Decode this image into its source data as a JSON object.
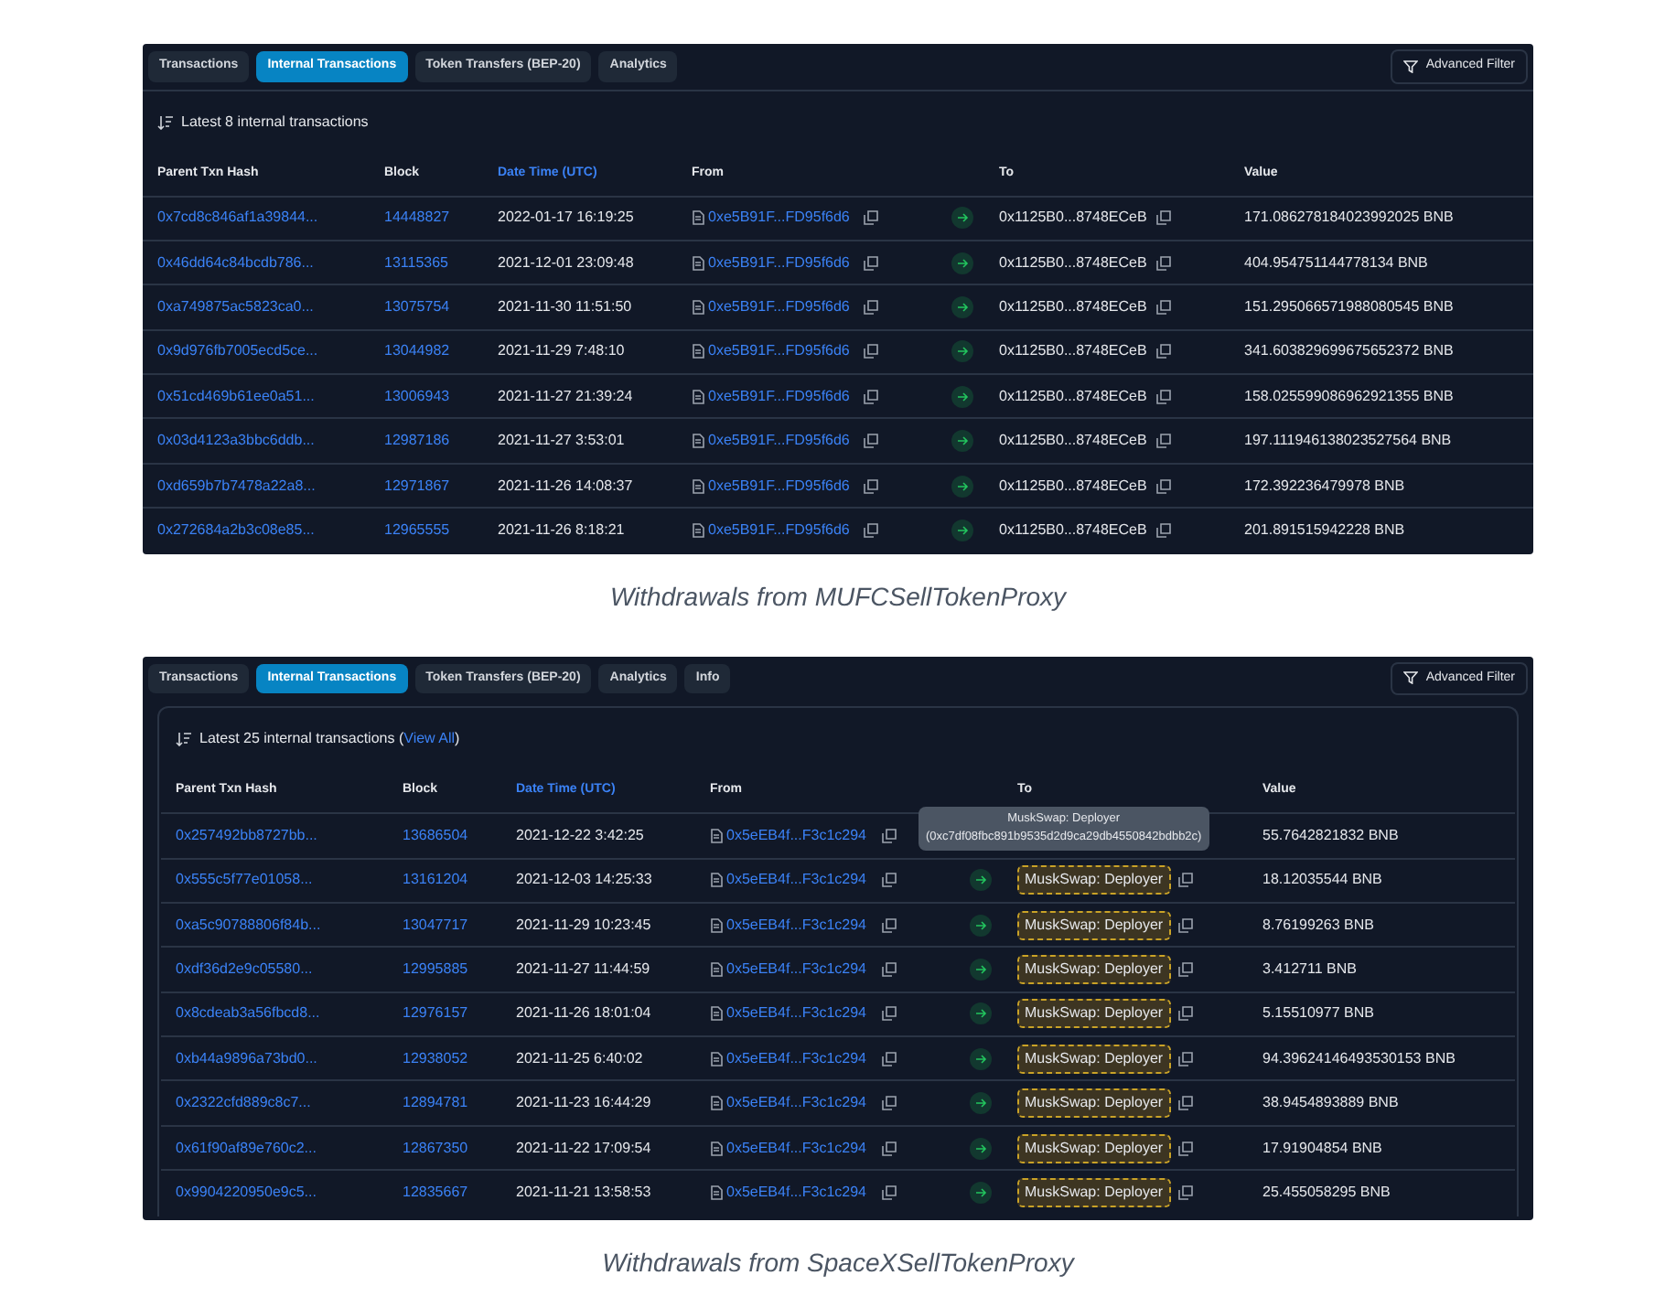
{
  "figures": [
    {
      "tabs": [
        {
          "label": "Transactions",
          "selected": false
        },
        {
          "label": "Internal Transactions",
          "selected": true
        },
        {
          "label": "Token Transfers (BEP-20)",
          "selected": false
        },
        {
          "label": "Analytics",
          "selected": false
        }
      ],
      "filter_button": "Advanced Filter",
      "inner_card": false,
      "summary": "Latest 8 internal transactions",
      "columns": [
        {
          "label": "Parent Txn Hash",
          "sortable": false
        },
        {
          "label": "Block",
          "sortable": false
        },
        {
          "label": "Date Time (UTC)",
          "sortable": true
        },
        {
          "label": "From",
          "sortable": false
        },
        {
          "label": "To",
          "sortable": false
        },
        {
          "label": "Value",
          "sortable": false
        }
      ],
      "rows": [
        {
          "hash": "0x7cd8c846af1a39844...",
          "block": "14448827",
          "time": "2022-01-17 16:19:25",
          "from": "0xe5B91F...FD95f6d6",
          "to": {
            "kind": "address",
            "text": "0x1125B0...8748ECeB"
          },
          "value": "171.086278184023992025 BNB"
        },
        {
          "hash": "0x46dd64c84bcdb786...",
          "block": "13115365",
          "time": "2021-12-01 23:09:48",
          "from": "0xe5B91F...FD95f6d6",
          "to": {
            "kind": "address",
            "text": "0x1125B0...8748ECeB"
          },
          "value": "404.954751144778134 BNB"
        },
        {
          "hash": "0xa749875ac5823ca0...",
          "block": "13075754",
          "time": "2021-11-30 11:51:50",
          "from": "0xe5B91F...FD95f6d6",
          "to": {
            "kind": "address",
            "text": "0x1125B0...8748ECeB"
          },
          "value": "151.295066571988080545 BNB"
        },
        {
          "hash": "0x9d976fb7005ecd5ce...",
          "block": "13044982",
          "time": "2021-11-29 7:48:10",
          "from": "0xe5B91F...FD95f6d6",
          "to": {
            "kind": "address",
            "text": "0x1125B0...8748ECeB"
          },
          "value": "341.603829699675652372 BNB"
        },
        {
          "hash": "0x51cd469b61ee0a51...",
          "block": "13006943",
          "time": "2021-11-27 21:39:24",
          "from": "0xe5B91F...FD95f6d6",
          "to": {
            "kind": "address",
            "text": "0x1125B0...8748ECeB"
          },
          "value": "158.025599086962921355 BNB"
        },
        {
          "hash": "0x03d4123a3bbc6ddb...",
          "block": "12987186",
          "time": "2021-11-27 3:53:01",
          "from": "0xe5B91F...FD95f6d6",
          "to": {
            "kind": "address",
            "text": "0x1125B0...8748ECeB"
          },
          "value": "197.111946138023527564 BNB"
        },
        {
          "hash": "0xd659b7b7478a22a8...",
          "block": "12971867",
          "time": "2021-11-26 14:08:37",
          "from": "0xe5B91F...FD95f6d6",
          "to": {
            "kind": "address",
            "text": "0x1125B0...8748ECeB"
          },
          "value": "172.392236479978 BNB"
        },
        {
          "hash": "0x272684a2b3c08e85...",
          "block": "12965555",
          "time": "2021-11-26 8:18:21",
          "from": "0xe5B91F...FD95f6d6",
          "to": {
            "kind": "address",
            "text": "0x1125B0...8748ECeB"
          },
          "value": "201.891515942228 BNB"
        }
      ],
      "caption": "Withdrawals from MUFCSellTokenProxy"
    },
    {
      "tabs": [
        {
          "label": "Transactions",
          "selected": false
        },
        {
          "label": "Internal Transactions",
          "selected": true
        },
        {
          "label": "Token Transfers (BEP-20)",
          "selected": false
        },
        {
          "label": "Analytics",
          "selected": false
        },
        {
          "label": "Info",
          "selected": false
        }
      ],
      "filter_button": "Advanced Filter",
      "inner_card": true,
      "summary": "Latest 25 internal transactions (",
      "view_all": "View All",
      "summary_end": ")",
      "columns": [
        {
          "label": "Parent Txn Hash",
          "sortable": false
        },
        {
          "label": "Block",
          "sortable": false
        },
        {
          "label": "Date Time (UTC)",
          "sortable": true
        },
        {
          "label": "From",
          "sortable": false
        },
        {
          "label": "To",
          "sortable": false
        },
        {
          "label": "Value",
          "sortable": false
        }
      ],
      "tooltip": {
        "title": "MuskSwap: Deployer",
        "address": "(0xc7df08fbc891b9535d2d9ca29db4550842bdbb2c)"
      },
      "rows": [
        {
          "hash": "0x257492bb8727bb...",
          "block": "13686504",
          "time": "2021-12-22 3:42:25",
          "from": "0x5eEB4f...F3c1c294",
          "value": "55.7642821832 BNB"
        },
        {
          "hash": "0x555c5f77e01058...",
          "block": "13161204",
          "time": "2021-12-03 14:25:33",
          "from": "0x5eEB4f...F3c1c294",
          "to": {
            "kind": "label",
            "text": "MuskSwap: Deployer"
          },
          "value": "18.12035544 BNB"
        },
        {
          "hash": "0xa5c90788806f84b...",
          "block": "13047717",
          "time": "2021-11-29 10:23:45",
          "from": "0x5eEB4f...F3c1c294",
          "to": {
            "kind": "label",
            "text": "MuskSwap: Deployer"
          },
          "value": "8.76199263 BNB"
        },
        {
          "hash": "0xdf36d2e9c05580...",
          "block": "12995885",
          "time": "2021-11-27 11:44:59",
          "from": "0x5eEB4f...F3c1c294",
          "to": {
            "kind": "label",
            "text": "MuskSwap: Deployer"
          },
          "value": "3.412711 BNB"
        },
        {
          "hash": "0x8cdeab3a56fbcd8...",
          "block": "12976157",
          "time": "2021-11-26 18:01:04",
          "from": "0x5eEB4f...F3c1c294",
          "to": {
            "kind": "label",
            "text": "MuskSwap: Deployer"
          },
          "value": "5.15510977 BNB"
        },
        {
          "hash": "0xb44a9896a73bd0...",
          "block": "12938052",
          "time": "2021-11-25 6:40:02",
          "from": "0x5eEB4f...F3c1c294",
          "to": {
            "kind": "label",
            "text": "MuskSwap: Deployer"
          },
          "value": "94.39624146493530153 BNB"
        },
        {
          "hash": "0x2322cfd889c8c7...",
          "block": "12894781",
          "time": "2021-11-23 16:44:29",
          "from": "0x5eEB4f...F3c1c294",
          "to": {
            "kind": "label",
            "text": "MuskSwap: Deployer"
          },
          "value": "38.9454893889 BNB"
        },
        {
          "hash": "0x61f90af89e760c2...",
          "block": "12867350",
          "time": "2021-11-22 17:09:54",
          "from": "0x5eEB4f...F3c1c294",
          "to": {
            "kind": "label",
            "text": "MuskSwap: Deployer"
          },
          "value": "17.91904854 BNB"
        },
        {
          "hash": "0x9904220950e9c5...",
          "block": "12835667",
          "time": "2021-11-21 13:58:53",
          "from": "0x5eEB4f...F3c1c294",
          "to": {
            "kind": "label",
            "text": "MuskSwap: Deployer"
          },
          "value": "25.455058295 BNB"
        }
      ],
      "caption": "Withdrawals from SpaceXSellTokenProxy"
    }
  ]
}
